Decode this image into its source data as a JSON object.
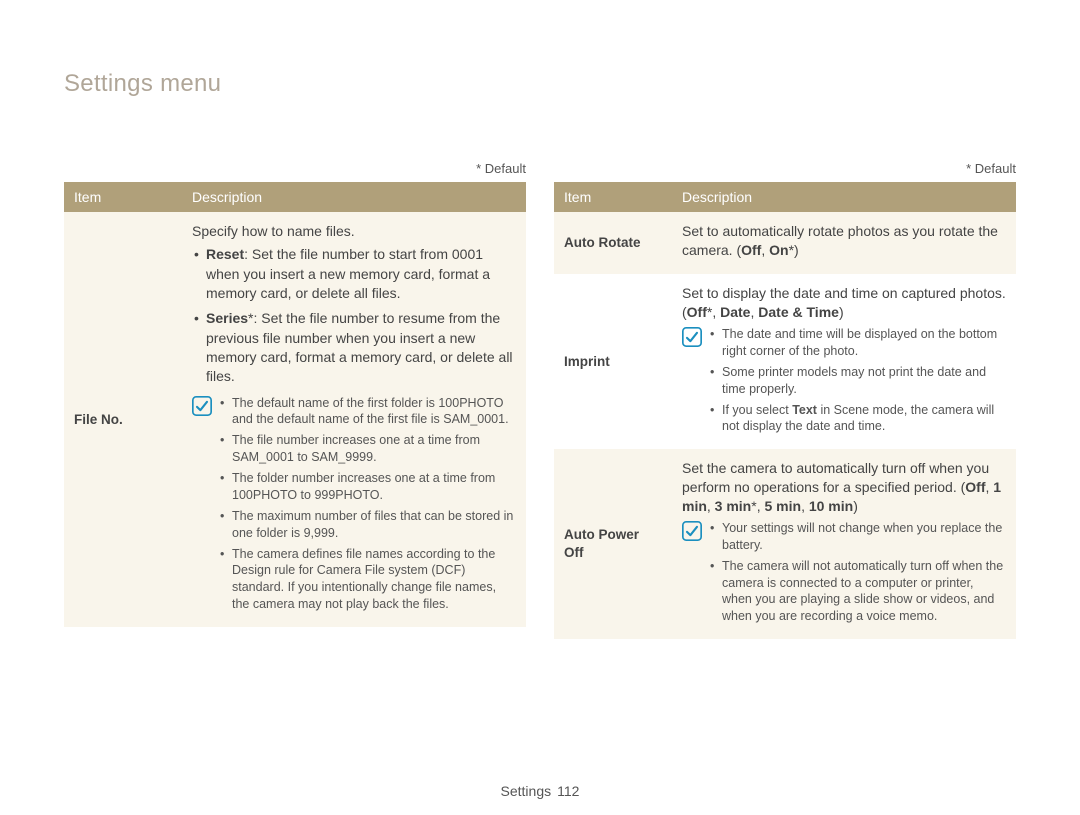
{
  "page": {
    "title": "Settings menu",
    "footer_section": "Settings",
    "page_number": "112",
    "default_note": "* Default",
    "headers": {
      "item": "Item",
      "description": "Description"
    }
  },
  "left": {
    "rows": [
      {
        "bg": "row-light",
        "item": "File No.",
        "intro": "Specify how to name files.",
        "bullets": [
          {
            "lead": "Reset",
            "after_lead": ": Set the file number to start from 0001 when you insert a new memory card, format a memory card, or delete all files."
          },
          {
            "lead": "Series",
            "star": "*",
            "after_lead": ": Set the file number to resume from the previous file number when you insert a new memory card, format a memory card, or delete all files."
          }
        ],
        "note_bullets": [
          "The default name of the first folder is 100PHOTO and the default name of the first file is SAM_0001.",
          "The file number increases one at a time from SAM_0001 to SAM_9999.",
          "The folder number increases one at a time from 100PHOTO to 999PHOTO.",
          "The maximum number of files that can be stored in one folder is 9,999.",
          "The camera defines file names according to the Design rule for Camera File system (DCF) standard. If you intentionally change file names, the camera may not play back the files."
        ]
      }
    ]
  },
  "right": {
    "rows": [
      {
        "bg": "row-light",
        "item": "Auto Rotate",
        "intro_pre": "Set to automatically rotate photos as you rotate the camera. (",
        "options": [
          {
            "text": "Off",
            "star": ""
          },
          {
            "text": "On",
            "star": "*"
          }
        ],
        "intro_post": ")"
      },
      {
        "bg": "row-white",
        "item": "Imprint",
        "intro_pre": "Set to display the date and time on captured photos. (",
        "options": [
          {
            "text": "Off",
            "star": "*"
          },
          {
            "text": "Date",
            "star": ""
          },
          {
            "text": "Date & Time",
            "star": ""
          }
        ],
        "intro_post": ")",
        "note_bullets": [
          "The date and time will be displayed on the bottom right corner of the photo.",
          "Some printer models may not print the date and time properly.",
          {
            "pre": "If you select ",
            "bold": "Text",
            "post": " in Scene mode, the camera will not display the date and time."
          }
        ]
      },
      {
        "bg": "row-light",
        "item": "Auto Power Off",
        "intro_pre": "Set the camera to automatically turn off when you perform no operations for a specified period. (",
        "options": [
          {
            "text": "Off",
            "star": ""
          },
          {
            "text": "1 min",
            "star": ""
          },
          {
            "text": "3 min",
            "star": "*"
          },
          {
            "text": "5 min",
            "star": ""
          },
          {
            "text": "10 min",
            "star": ""
          }
        ],
        "intro_post": ")",
        "note_bullets": [
          "Your settings will not change when you replace the battery.",
          "The camera will not automatically turn off when the camera is connected to a computer or printer, when you are playing a slide show or videos, and when you are recording a voice memo."
        ]
      }
    ]
  }
}
